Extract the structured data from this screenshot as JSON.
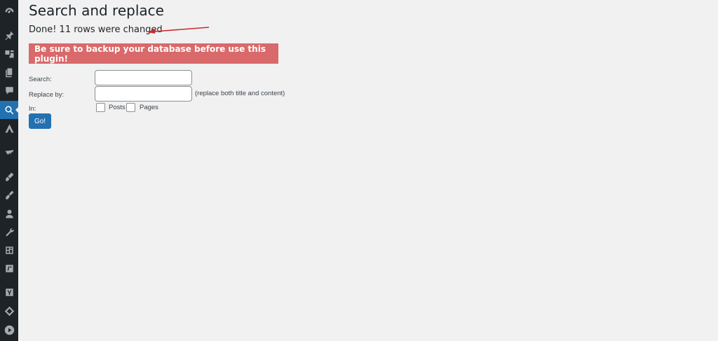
{
  "page": {
    "title": "Search and replace",
    "result_message": "Done! 11 rows were changed",
    "warning": "Be sure to backup your database before use this plugin!"
  },
  "form": {
    "search_label": "Search:",
    "search_value": "",
    "replace_label": "Replace by:",
    "replace_value": "",
    "replace_hint": "(replace both title and content)",
    "in_label": "In:",
    "options": [
      {
        "label": "Posts",
        "checked": false
      },
      {
        "label": "Pages",
        "checked": false
      }
    ],
    "submit_label": "Go!"
  },
  "sidebar": {
    "icons": [
      "dashboard-icon",
      "pin-icon",
      "media-icon",
      "pages-icon",
      "comments-icon",
      "search-replace-icon",
      "astra-icon",
      "plugin-icon",
      "appearance-icon",
      "brush-icon",
      "users-icon",
      "tools-icon",
      "settings-icon",
      "snippet-icon",
      "yoast-icon",
      "diamond-icon",
      "play-icon"
    ],
    "active": "search-replace-icon"
  },
  "colors": {
    "sidebar_bg": "#1d2327",
    "accent": "#2271b1",
    "warning_bg": "#d9696a",
    "annotation_arrow": "#cc2a2a"
  }
}
